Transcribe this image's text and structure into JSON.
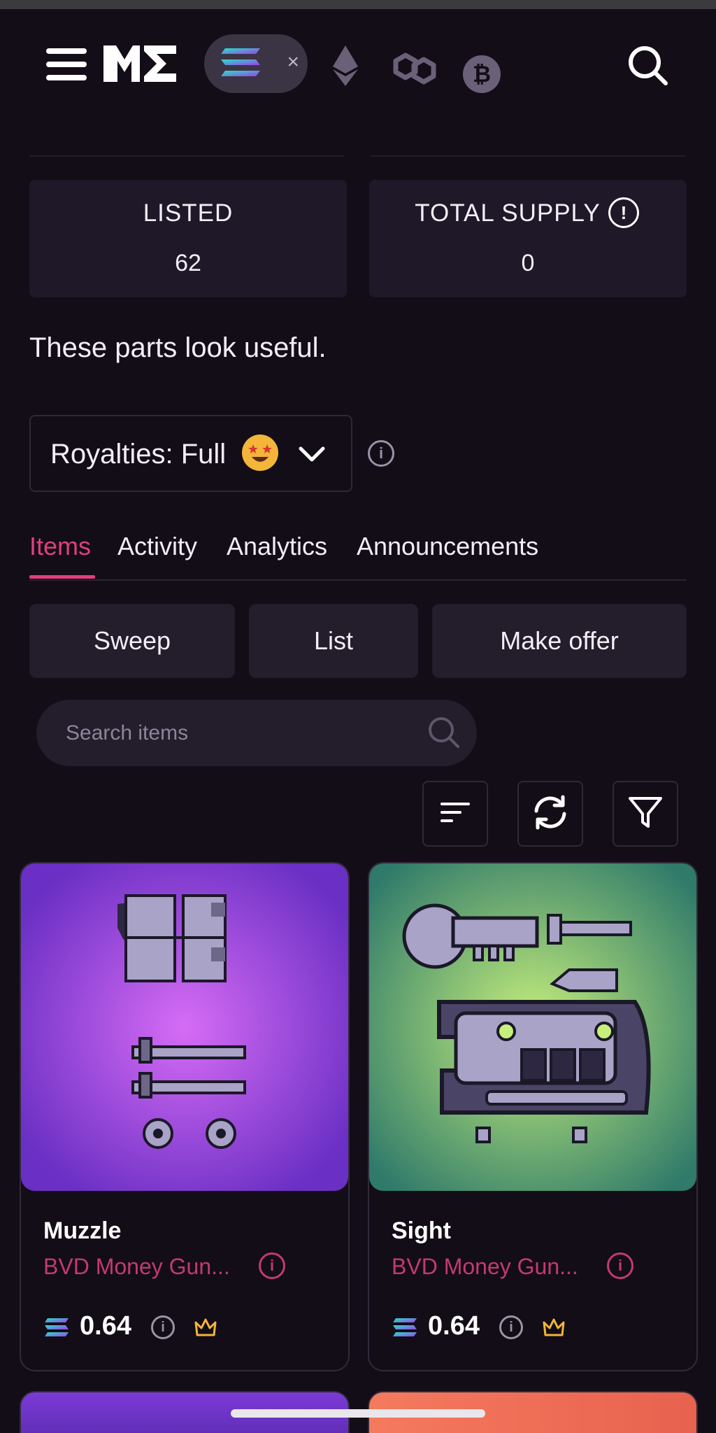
{
  "navbar": {
    "active_chain": "solana",
    "chip_close": "×",
    "btc_symbol": "₿"
  },
  "stats": {
    "listed_label": "LISTED",
    "listed_value": "62",
    "supply_label": "TOTAL SUPPLY",
    "supply_value": "0",
    "info_glyph": "!"
  },
  "description": "These parts look useful.",
  "royalties": {
    "label": "Royalties: Full",
    "info_glyph": "i"
  },
  "tabs": [
    {
      "label": "Items",
      "active": true
    },
    {
      "label": "Activity",
      "active": false
    },
    {
      "label": "Analytics",
      "active": false
    },
    {
      "label": "Announcements",
      "active": false
    }
  ],
  "actions": {
    "sweep": "Sweep",
    "list": "List",
    "make_offer": "Make offer"
  },
  "search": {
    "placeholder": "Search items"
  },
  "tools": [
    "sort-icon",
    "refresh-icon",
    "filter-icon"
  ],
  "cards": [
    {
      "name": "Muzzle",
      "collection": "BVD Money Gun...",
      "price": "0.64",
      "info_glyph": "i",
      "image_bg": "#a24ee8"
    },
    {
      "name": "Sight",
      "collection": "BVD Money Gun...",
      "price": "0.64",
      "info_glyph": "i",
      "image_bg": "#8fc466"
    }
  ],
  "colors": {
    "background": "#120d17",
    "accent": "#e0407b",
    "card_surface": "#1e1828",
    "collection_text": "#c43a6f",
    "crown": "#f3b53a"
  }
}
